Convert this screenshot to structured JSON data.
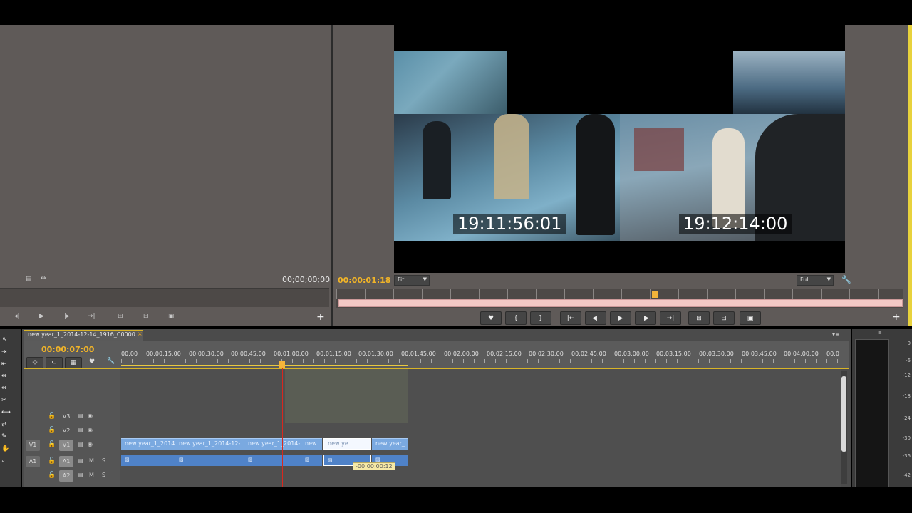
{
  "source_monitor": {
    "timecode": "00;00;00;00"
  },
  "program_monitor": {
    "timecode": "00:00:01:18",
    "zoom_select": "Fit",
    "resolution_select": "Full",
    "video_timecodes": [
      "19:11:56:01",
      "19:12:14:00"
    ]
  },
  "timeline": {
    "sequence_tab": "new year_1_2014-12-14_1916_C0000",
    "current_time": "00:00:07:00",
    "ruler": [
      "00:00",
      "00:00:15:00",
      "00:00:30:00",
      "00:00:45:00",
      "00:01:00:00",
      "00:01:15:00",
      "00:01:30:00",
      "00:01:45:00",
      "00:02:00:00",
      "00:02:15:00",
      "00:02:30:00",
      "00:02:45:00",
      "00:03:00:00",
      "00:03:15:00",
      "00:03:30:00",
      "00:03:45:00",
      "00:04:00:00",
      "00:0"
    ],
    "tracks": {
      "v3": "V3",
      "v2": "V2",
      "v1_src": "V1",
      "v1": "V1",
      "a1_src": "A1",
      "a1": "A1",
      "a2": "A2",
      "mute": "M",
      "solo": "S"
    },
    "video_clips": [
      "new year_1_2014-",
      "new year_1_2014-12-",
      "new year_1_2014-",
      "new",
      "new ye",
      "new year_"
    ],
    "trim_tooltip": "-00:00:00:12"
  },
  "audio_meter": {
    "labels": [
      "0",
      "-6",
      "-12",
      "-18",
      "-24",
      "-30",
      "-36",
      "-42"
    ]
  }
}
